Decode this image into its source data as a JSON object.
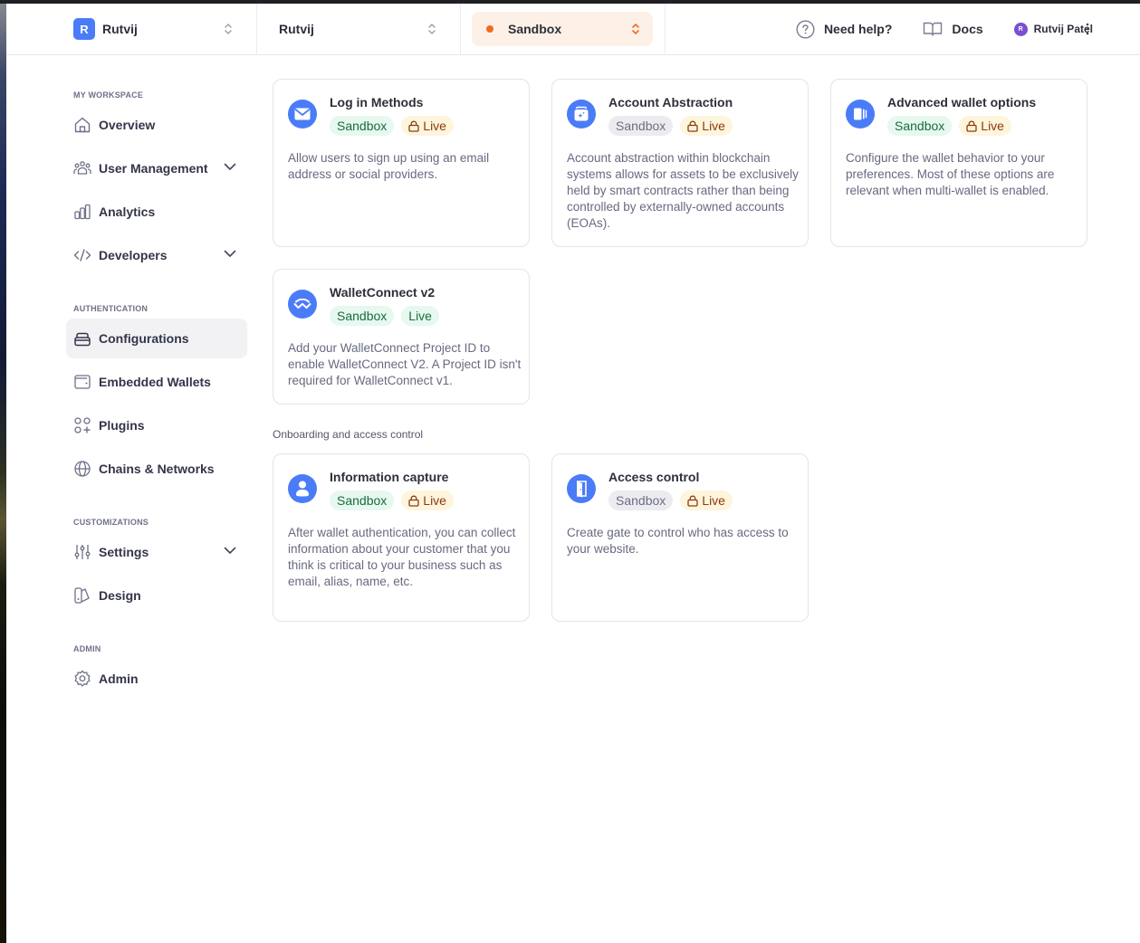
{
  "header": {
    "org": {
      "initial": "R",
      "name": "Rutvij"
    },
    "project": {
      "name": "Rutvij"
    },
    "environment": {
      "name": "Sandbox",
      "color": "#f26b1d"
    },
    "help_label": "Need help?",
    "docs_label": "Docs",
    "user": {
      "initial": "R",
      "name": "Rutvij Patel"
    }
  },
  "sidebar": {
    "sections": [
      {
        "title": "MY WORKSPACE",
        "items": [
          {
            "label": "Overview",
            "icon": "home-icon"
          },
          {
            "label": "User Management",
            "icon": "users-icon",
            "expandable": true
          },
          {
            "label": "Analytics",
            "icon": "bar-chart-icon"
          },
          {
            "label": "Developers",
            "icon": "code-icon",
            "expandable": true
          }
        ]
      },
      {
        "title": "AUTHENTICATION",
        "items": [
          {
            "label": "Configurations",
            "icon": "stack-icon",
            "active": true
          },
          {
            "label": "Embedded Wallets",
            "icon": "wallet-icon"
          },
          {
            "label": "Plugins",
            "icon": "plugins-icon"
          },
          {
            "label": "Chains & Networks",
            "icon": "globe-icon"
          }
        ]
      },
      {
        "title": "CUSTOMIZATIONS",
        "items": [
          {
            "label": "Settings",
            "icon": "sliders-icon",
            "expandable": true
          },
          {
            "label": "Design",
            "icon": "palette-icon"
          }
        ]
      },
      {
        "title": "ADMIN",
        "items": [
          {
            "label": "Admin",
            "icon": "gear-icon"
          }
        ]
      }
    ]
  },
  "main": {
    "cards": [
      {
        "title": "Log in Methods",
        "icon": "envelope-icon",
        "sandbox": {
          "label": "Sandbox",
          "state": "enabled"
        },
        "live": {
          "label": "Live",
          "locked": true
        },
        "description": "Allow users to sign up using an email address or social providers."
      },
      {
        "title": "Account Abstraction",
        "icon": "smart-wallet-icon",
        "sandbox": {
          "label": "Sandbox",
          "state": "disabled"
        },
        "live": {
          "label": "Live",
          "locked": true
        },
        "description": "Account abstraction within blockchain systems allows for assets to be exclusively held by smart contracts rather than being controlled by externally-owned accounts (EOAs)."
      },
      {
        "title": "Advanced wallet options",
        "icon": "wallets-icon",
        "sandbox": {
          "label": "Sandbox",
          "state": "enabled"
        },
        "live": {
          "label": "Live",
          "locked": true
        },
        "description": "Configure the wallet behavior to your preferences. Most of these options are relevant when multi-wallet is enabled."
      },
      {
        "title": "WalletConnect v2",
        "icon": "walletconnect-icon",
        "sandbox": {
          "label": "Sandbox",
          "state": "enabled"
        },
        "live": {
          "label": "Live",
          "locked": false
        },
        "description": "Add your WalletConnect Project ID to enable WalletConnect V2. A Project ID isn't required for WalletConnect v1."
      }
    ],
    "group_label": "Onboarding and access control",
    "group_cards": [
      {
        "title": "Information capture",
        "icon": "user-icon",
        "sandbox": {
          "label": "Sandbox",
          "state": "enabled"
        },
        "live": {
          "label": "Live",
          "locked": true
        },
        "description": "After wallet authentication, you can collect information about your customer that you think is critical to your business such as email, alias, name, etc."
      },
      {
        "title": "Access control",
        "icon": "door-icon",
        "sandbox": {
          "label": "Sandbox",
          "state": "disabled"
        },
        "live": {
          "label": "Live",
          "locked": true
        },
        "description": "Create gate to control who has access to your website."
      }
    ]
  }
}
